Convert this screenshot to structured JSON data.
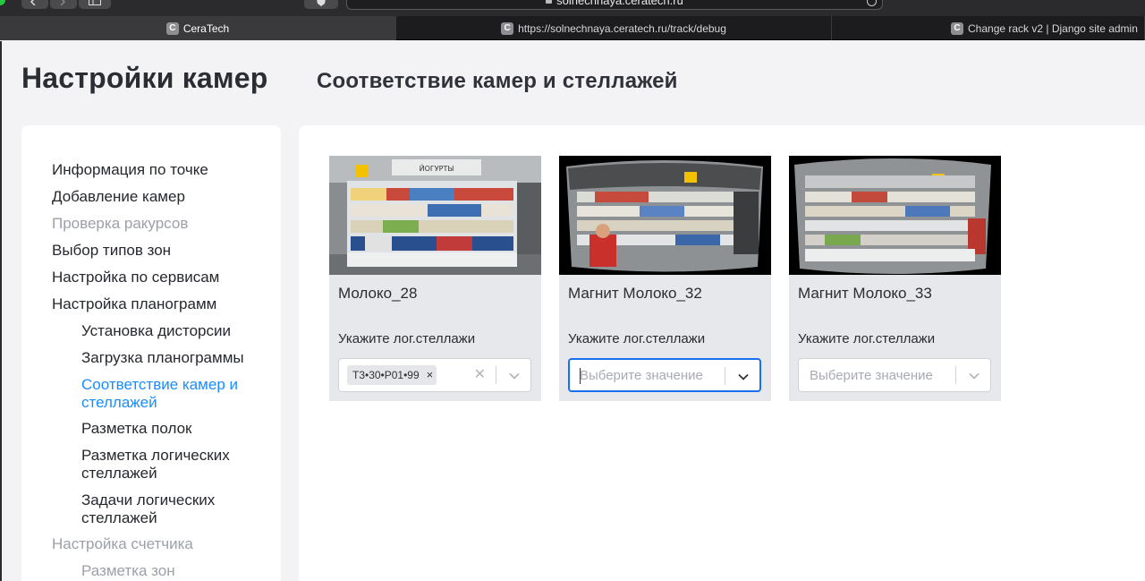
{
  "browser": {
    "address": "solnechnaya.ceratech.ru",
    "tabs": [
      {
        "favicon": "C",
        "title": "CeraTech"
      },
      {
        "favicon": "C",
        "title": "https://solnechnaya.ceratech.ru/track/debug"
      },
      {
        "favicon": "C",
        "title": "Change rack v2 | Django site admin"
      }
    ]
  },
  "page": {
    "title": "Настройки камер",
    "section_title": "Соответствие камер и стеллажей"
  },
  "sidebar": {
    "items": [
      {
        "label": "Информация по точке",
        "state": "normal"
      },
      {
        "label": "Добавление камер",
        "state": "normal"
      },
      {
        "label": "Проверка ракурсов",
        "state": "muted"
      },
      {
        "label": "Выбор типов зон",
        "state": "normal"
      },
      {
        "label": "Настройка по сервисам",
        "state": "normal"
      },
      {
        "label": "Настройка планограмм",
        "state": "normal"
      },
      {
        "label": "Установка дисторсии",
        "state": "normal"
      },
      {
        "label": "Загрузка планограммы",
        "state": "normal"
      },
      {
        "label": "Соответствие камер и стеллажей",
        "state": "active"
      },
      {
        "label": "Разметка полок",
        "state": "normal"
      },
      {
        "label": "Разметка логических стеллажей",
        "state": "normal"
      },
      {
        "label": "Задачи логических стеллажей",
        "state": "normal"
      },
      {
        "label": "Настройка счетчика",
        "state": "muted"
      },
      {
        "label": "Разметка зон",
        "state": "muted"
      }
    ]
  },
  "cards": [
    {
      "thumb_sign": "ЙОГУРТЫ",
      "name": "Молоко_28",
      "label": "Укажите лог.стеллажи",
      "tag": "Т3•30•Р01•99",
      "placeholder": ""
    },
    {
      "thumb_sign": "",
      "name": "Магнит Молоко_32",
      "label": "Укажите лог.стеллажи",
      "tag": "",
      "placeholder": "Выберите значение"
    },
    {
      "thumb_sign": "",
      "name": "Магнит Молоко_33",
      "label": "Укажите лог.стеллажи",
      "tag": "",
      "placeholder": "Выберите значение"
    }
  ],
  "colors": {
    "accent": "#1a8cff",
    "focus_border": "#1a6ff0",
    "muted_text": "#9ca0a8"
  }
}
